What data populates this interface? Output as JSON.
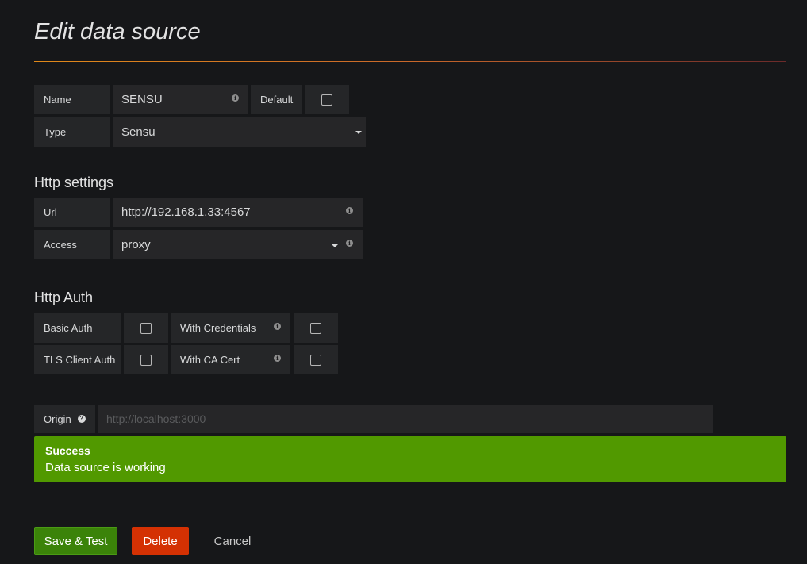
{
  "page": {
    "title": "Edit data source"
  },
  "general": {
    "name_label": "Name",
    "name_value": "SENSU",
    "default_label": "Default",
    "default_checked": false,
    "type_label": "Type",
    "type_value": "Sensu"
  },
  "http_settings": {
    "heading": "Http settings",
    "url_label": "Url",
    "url_value": "http://192.168.1.33:4567",
    "access_label": "Access",
    "access_value": "proxy"
  },
  "http_auth": {
    "heading": "Http Auth",
    "basic_auth_label": "Basic Auth",
    "basic_auth_checked": false,
    "with_credentials_label": "With Credentials",
    "with_credentials_checked": false,
    "tls_client_auth_label": "TLS Client Auth",
    "tls_client_auth_checked": false,
    "with_ca_cert_label": "With CA Cert",
    "with_ca_cert_checked": false
  },
  "origin": {
    "label": "Origin",
    "placeholder": "http://localhost:3000",
    "value": ""
  },
  "alert": {
    "title": "Success",
    "message": "Data source is working",
    "color": "#519900"
  },
  "actions": {
    "save_label": "Save & Test",
    "delete_label": "Delete",
    "cancel_label": "Cancel"
  },
  "icons": {
    "info": "info-icon",
    "help": "question-circle-icon",
    "caret": "caret-down-icon"
  },
  "colors": {
    "background": "#161719",
    "save": "#3b8309",
    "delete": "#d43103"
  }
}
